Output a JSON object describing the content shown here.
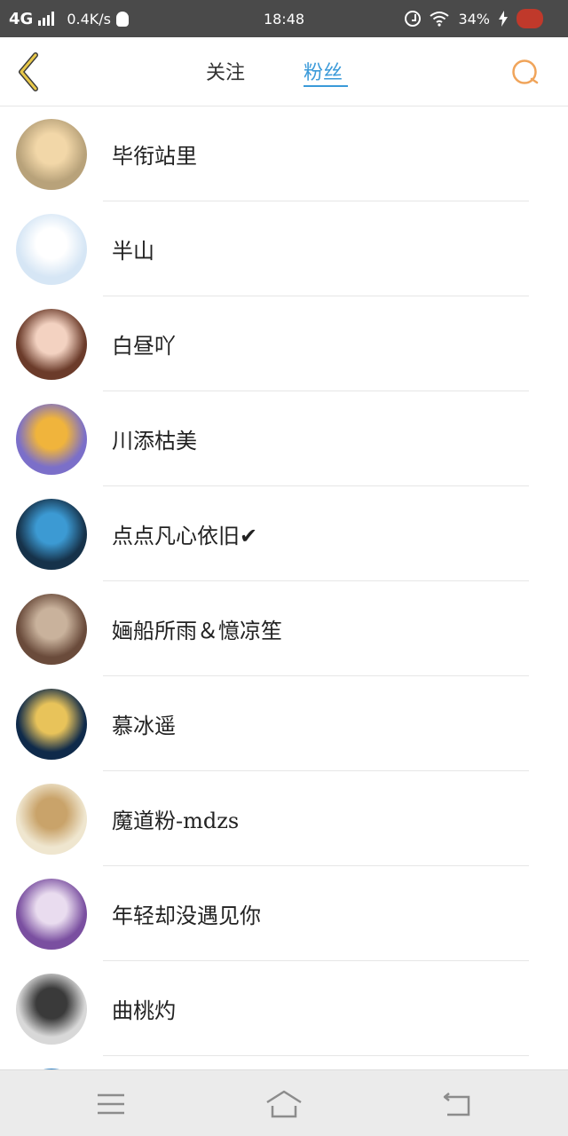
{
  "status_bar": {
    "network": "4G",
    "speed": "0.4K/s",
    "time": "18:48",
    "battery": "34%"
  },
  "header": {
    "tabs": [
      {
        "label": "关注",
        "active": false
      },
      {
        "label": "粉丝",
        "active": true
      }
    ],
    "accent_color": "#3a9ad9",
    "back_icon": "chevron-left-icon",
    "search_icon": "search-icon"
  },
  "fans": [
    {
      "name": "毕衔站里",
      "avatar_color": "#b8a27a",
      "avatar_accent": "#f2d7a8"
    },
    {
      "name": "半山",
      "avatar_color": "#d6e6f5",
      "avatar_accent": "#ffffff"
    },
    {
      "name": "白昼吖",
      "avatar_color": "#6b3b2a",
      "avatar_accent": "#f3d2c1"
    },
    {
      "name": "川添枯美",
      "avatar_color": "#7b6fc9",
      "avatar_accent": "#f0b43c"
    },
    {
      "name": "点点凡心依旧✔",
      "avatar_color": "#16324a",
      "avatar_accent": "#3c9ad3"
    },
    {
      "name": "婳船所雨＆憶凉笙",
      "avatar_color": "#6a4b3b",
      "avatar_accent": "#c9b29c"
    },
    {
      "name": "慕冰遥",
      "avatar_color": "#0f2a4a",
      "avatar_accent": "#e8c35a"
    },
    {
      "name": "魔道粉-mdzs",
      "avatar_color": "#efe6cf",
      "avatar_accent": "#c9a36a"
    },
    {
      "name": "年轻却没遇见你",
      "avatar_color": "#7a4fa0",
      "avatar_accent": "#e9dcef"
    },
    {
      "name": "曲桃灼",
      "avatar_color": "#d8d8d8",
      "avatar_accent": "#3a3a3a"
    },
    {
      "name": "",
      "avatar_color": "#2d7fc1",
      "avatar_accent": "#2d7fc1"
    }
  ],
  "nav_bar": {
    "menu_icon": "menu-icon",
    "home_icon": "home-icon",
    "back_icon": "back-icon"
  }
}
